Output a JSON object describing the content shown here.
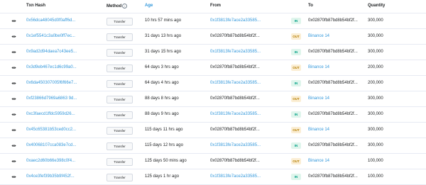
{
  "headers": {
    "txn_hash": "Txn Hash",
    "method": "Method",
    "method_info": "i",
    "age": "Age",
    "from": "From",
    "to": "To",
    "quantity": "Quantity"
  },
  "colors": {
    "link": "#3498db",
    "in_badge": "#00a186",
    "out_badge": "#b47d00"
  },
  "rows": [
    {
      "hash": "0x56dca48045d0f0aff6d...",
      "method": "Transfer",
      "age": "10 hrs 57 mins ago",
      "from": "0x1f3813fe7ace2a33585...",
      "from_link": true,
      "dir": "IN",
      "to": "0x02870fb87bd8b54bf2f...",
      "to_link": false,
      "qty": "300,000"
    },
    {
      "hash": "0x1ef5541c3a0be0ff7ec...",
      "method": "Transfer",
      "age": "31 days 13 hrs ago",
      "from": "0x02870fb87bd8b54bf2f...",
      "from_link": false,
      "dir": "OUT",
      "to": "Binance 14",
      "to_link": true,
      "qty": "300,000"
    },
    {
      "hash": "0x9ad2d94daea7c43ee5...",
      "method": "Transfer",
      "age": "31 days 15 hrs ago",
      "from": "0x1f3813fe7ace2a33585...",
      "from_link": true,
      "dir": "IN",
      "to": "0x02870fb87bd8b54bf2f...",
      "to_link": false,
      "qty": "300,000"
    },
    {
      "hash": "0x3d9eb467ec1d6c99a0...",
      "method": "Transfer",
      "age": "64 days 3 hrs ago",
      "from": "0x02870fb87bd8b54bf2f...",
      "from_link": false,
      "dir": "OUT",
      "to": "Binance 14",
      "to_link": true,
      "qty": "200,000"
    },
    {
      "hash": "0x6da450307005f6f66e7...",
      "method": "Transfer",
      "age": "64 days 4 hrs ago",
      "from": "0x1f3813fe7ace2a33585...",
      "from_link": true,
      "dir": "IN",
      "to": "0x02870fb87bd8b54bf2f...",
      "to_link": false,
      "qty": "200,000"
    },
    {
      "hash": "0xf23866d7969a6863 9d...",
      "method": "Transfer",
      "age": "88 days 8 hrs ago",
      "from": "0x02870fb87bd8b54bf2f...",
      "from_link": false,
      "dir": "OUT",
      "to": "Binance 14",
      "to_link": true,
      "qty": "300,000"
    },
    {
      "hash": "0xc3faecd1ffdc5959d26...",
      "method": "Transfer",
      "age": "88 days 9 hrs ago",
      "from": "0x1f3813fe7ace2a33585...",
      "from_link": true,
      "dir": "IN",
      "to": "0x02870fb87bd8b54bf2f...",
      "to_link": false,
      "qty": "300,000"
    },
    {
      "hash": "0x45c65381b53ced0cc2...",
      "method": "Transfer",
      "age": "115 days 11 hrs ago",
      "from": "0x02870fb87bd8b54bf2f...",
      "from_link": false,
      "dir": "OUT",
      "to": "Binance 14",
      "to_link": true,
      "qty": "300,000"
    },
    {
      "hash": "0x40068107cca083e7cd...",
      "method": "Transfer",
      "age": "115 days 12 hrs ago",
      "from": "0x1f3813fe7ace2a33585...",
      "from_link": true,
      "dir": "IN",
      "to": "0x02870fb87bd8b54bf2f...",
      "to_link": false,
      "qty": "300,000"
    },
    {
      "hash": "0xaec2d60b66e398c0f4...",
      "method": "Transfer",
      "age": "125 days 50 mins ago",
      "from": "0x02870fb87bd8b54bf2f...",
      "from_link": false,
      "dir": "OUT",
      "to": "Binance 14",
      "to_link": true,
      "qty": "100,000"
    },
    {
      "hash": "0x4ce3fef39b35b9f452f...",
      "method": "Transfer",
      "age": "125 days 1 hr ago",
      "from": "0x1f3813fe7ace2a33585...",
      "from_link": true,
      "dir": "IN",
      "to": "0x02870fb87bd8b54bf2f...",
      "to_link": false,
      "qty": "100,000"
    }
  ]
}
